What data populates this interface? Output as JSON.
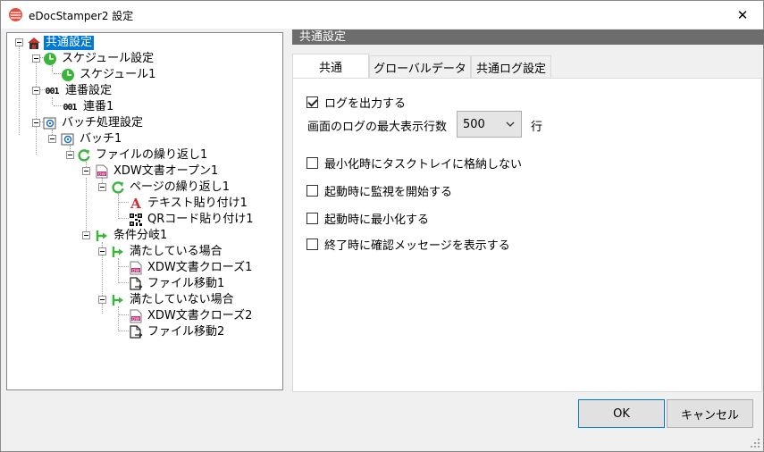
{
  "window": {
    "title": "eDocStamper2 設定",
    "close_glyph": "✕"
  },
  "tree": {
    "items": [
      {
        "label": "共通設定",
        "icon": "house-icon"
      },
      {
        "label": "スケジュール設定",
        "icon": "clock-icon"
      },
      {
        "label": "スケジュール1",
        "icon": "clock-icon"
      },
      {
        "label": "連番設定",
        "icon": "sequence-icon",
        "icon_text": "001"
      },
      {
        "label": "連番1",
        "icon": "sequence-icon",
        "icon_text": "001"
      },
      {
        "label": "バッチ処理設定",
        "icon": "batch-icon"
      },
      {
        "label": "バッチ1",
        "icon": "batch-icon"
      },
      {
        "label": "ファイルの繰り返し1",
        "icon": "loop-icon"
      },
      {
        "label": "XDW文書オープン1",
        "icon": "xdw-document-icon"
      },
      {
        "label": "ページの繰り返し1",
        "icon": "loop-icon"
      },
      {
        "label": "テキスト貼り付け1",
        "icon": "text-stamp-icon",
        "icon_text": "A"
      },
      {
        "label": "QRコード貼り付け1",
        "icon": "qr-code-icon"
      },
      {
        "label": "条件分岐1",
        "icon": "branch-icon"
      },
      {
        "label": "満たしている場合",
        "icon": "branch-icon"
      },
      {
        "label": "XDW文書クローズ1",
        "icon": "xdw-document-icon"
      },
      {
        "label": "ファイル移動1",
        "icon": "file-move-icon"
      },
      {
        "label": "満たしていない場合",
        "icon": "branch-icon"
      },
      {
        "label": "XDW文書クローズ2",
        "icon": "xdw-document-icon"
      },
      {
        "label": "ファイル移動2",
        "icon": "file-move-icon"
      }
    ]
  },
  "panel": {
    "header": "共通設定",
    "tabs": [
      {
        "label": "共通",
        "active": true
      },
      {
        "label": "グローバルデータ",
        "active": false
      },
      {
        "label": "共通ログ設定",
        "active": false
      }
    ],
    "log_output": {
      "label": "ログを出力する",
      "checked": true
    },
    "max_lines": {
      "label": "画面のログの最大表示行数",
      "value": "500",
      "unit": "行"
    },
    "options": [
      {
        "label": "最小化時にタスクトレイに格納しない",
        "checked": false
      },
      {
        "label": "起動時に監視を開始する",
        "checked": false
      },
      {
        "label": "起動時に最小化する",
        "checked": false
      },
      {
        "label": "終了時に確認メッセージを表示する",
        "checked": false
      }
    ]
  },
  "buttons": {
    "ok": "OK",
    "cancel": "キャンセル"
  },
  "colors": {
    "selection": "#0078d7",
    "panel_header": "#6d6d6d",
    "green_icon": "#3cb43c",
    "red_icon": "#d12c2c"
  }
}
